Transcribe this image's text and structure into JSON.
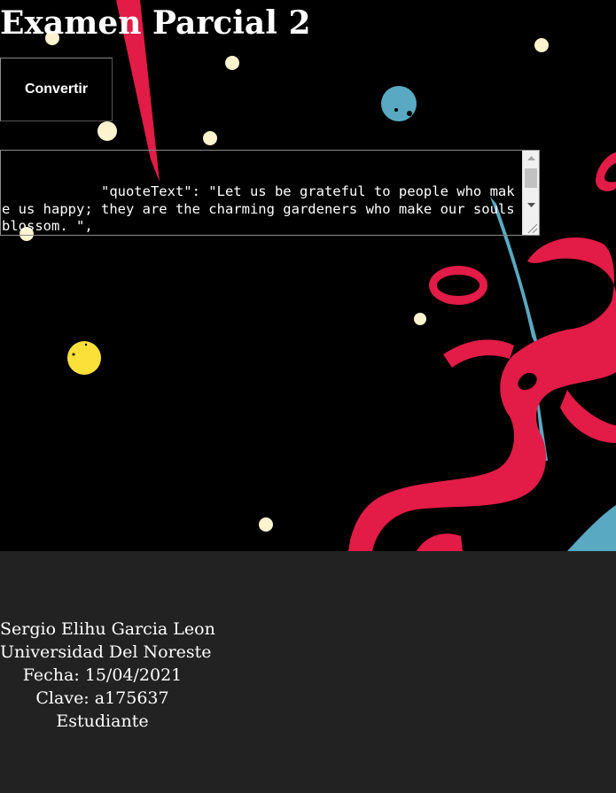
{
  "page": {
    "title": "Examen Parcial 2"
  },
  "controls": {
    "convert_label": "Convertir"
  },
  "output": {
    "text": "            \"quoteText\": \"Let us be grateful to people who make us happy; they are the charming gardeners who make our souls blossom. \","
  },
  "footer": {
    "name": "Sergio Elihu Garcia Leon",
    "university": "Universidad Del Noreste",
    "date": "Fecha: 15/04/2021",
    "id": "Clave: a175637",
    "role": "Estudiante"
  },
  "colors": {
    "background": "#000000",
    "footer_background": "#222222",
    "splash_red": "#e21b47",
    "splash_blue": "#5aa9c2",
    "dot_cream": "#fdf3cf",
    "dot_yellow": "#fbe03a"
  },
  "icons": {
    "scroll_up": "triangle-up-icon",
    "scroll_down": "triangle-down-icon",
    "resize": "resize-grip-icon"
  }
}
